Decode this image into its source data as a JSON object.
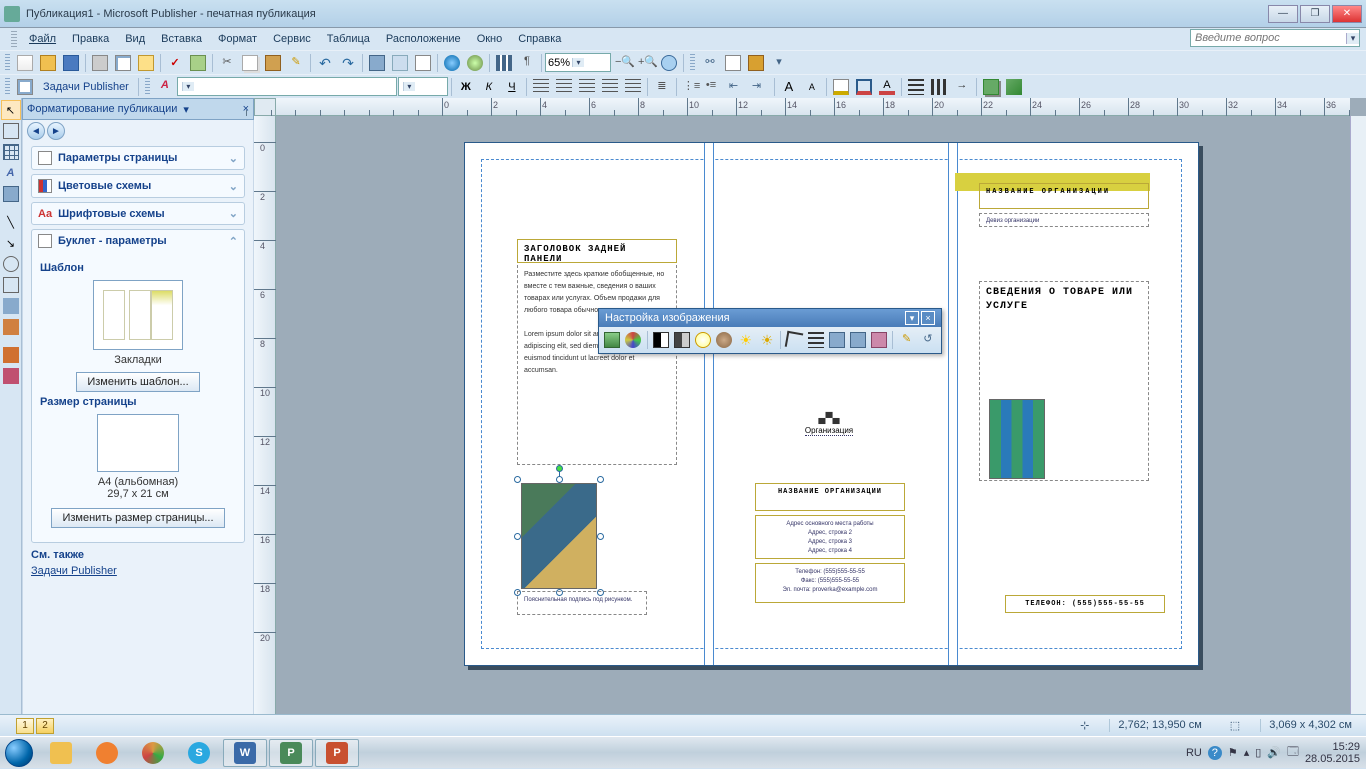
{
  "window": {
    "title": "Публикация1 - Microsoft Publisher - печатная публикация"
  },
  "menu": {
    "items": [
      "Файл",
      "Правка",
      "Вид",
      "Вставка",
      "Формат",
      "Сервис",
      "Таблица",
      "Расположение",
      "Окно",
      "Справка"
    ],
    "question_placeholder": "Введите вопрос"
  },
  "standard_toolbar": {
    "zoom": "65%"
  },
  "tasks_toolbar_label": "Задачи Publisher",
  "formatting": {
    "font_name": "",
    "font_size": ""
  },
  "task_pane": {
    "title": "Форматирование публикации",
    "sections": {
      "page_params": "Параметры страницы",
      "color_schemes": "Цветовые схемы",
      "font_schemes": "Шрифтовые схемы",
      "booklet": "Буклет - параметры"
    },
    "template_label": "Шаблон",
    "template_name": "Закладки",
    "change_template": "Изменить шаблон...",
    "page_size_label": "Размер страницы",
    "page_format": "A4 (альбомная)",
    "page_dim": "29,7 x 21 см",
    "change_page_size": "Изменить размер страницы...",
    "see_also": "См. также",
    "see_also_link": "Задачи Publisher"
  },
  "page": {
    "panel1": {
      "heading": "ЗАГОЛОВОК ЗАДНЕЙ ПАНЕЛИ",
      "para1": "Разместите здесь краткие обобщенные, но вместе с тем важные, сведения о ваших товарах или услугах. Объем продажи для любого товара обычно составляет",
      "para2": "Lorem ipsum dolor sit amet, consectetuer adipiscing elit, sed diem nonummy nibh euismod tincidunt ut lacreet dolor et accumsan.",
      "caption": "Пояснительная подпись под рисунком."
    },
    "panel2": {
      "org_logo_label": "Организация",
      "org_name": "НАЗВАНИЕ ОРГАНИЗАЦИИ",
      "addr": "Адрес основного места работы\nАдрес, строка 2\nАдрес, строка 3\nАдрес, строка 4",
      "phone_block": "Телефон: (555)555-55-55\nФакс: (555)555-55-55\nЭл. почта: proverka@example.com"
    },
    "panel3": {
      "org_name": "НАЗВАНИЕ ОРГАНИЗАЦИИ",
      "slogan": "Девиз организации",
      "heading": "СВЕДЕНИЯ О ТОВАРЕ ИЛИ УСЛУГЕ",
      "phone": "ТЕЛЕФОН: (555)555-55-55"
    }
  },
  "picture_toolbar": {
    "title": "Настройка изображения"
  },
  "status": {
    "pages": [
      "1",
      "2"
    ],
    "coords": "2,762; 13,950 см",
    "size": "3,069 x 4,302 см"
  },
  "tray": {
    "lang": "RU",
    "time": "15:29",
    "date": "28.05.2015"
  },
  "ruler_h": [
    "0",
    "2",
    "4",
    "6",
    "8",
    "10",
    "12",
    "14",
    "16",
    "18",
    "20",
    "22",
    "24",
    "26",
    "28",
    "30",
    "32",
    "34",
    "36"
  ],
  "ruler_v": [
    "0",
    "2",
    "4",
    "6",
    "8",
    "10",
    "12",
    "14",
    "16",
    "18",
    "20"
  ]
}
